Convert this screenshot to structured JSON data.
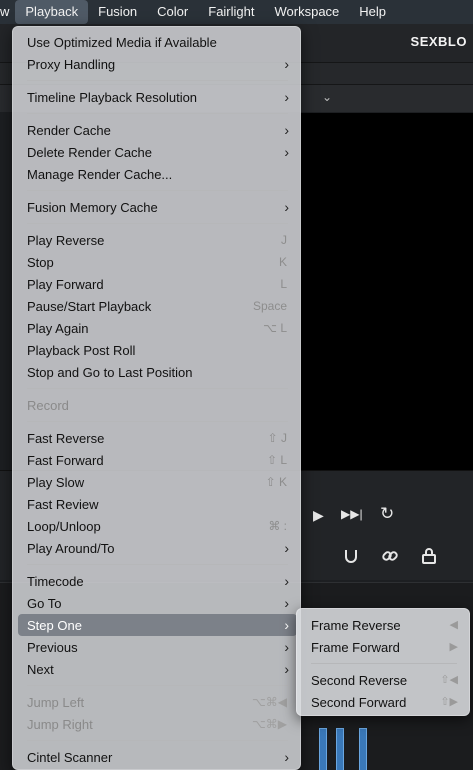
{
  "menubar": {
    "items": [
      {
        "label": "w"
      },
      {
        "label": "Playback",
        "active": true
      },
      {
        "label": "Fusion"
      },
      {
        "label": "Color"
      },
      {
        "label": "Fairlight"
      },
      {
        "label": "Workspace"
      },
      {
        "label": "Help"
      }
    ]
  },
  "app": {
    "title": "SEXBLO"
  },
  "menu": {
    "items": [
      {
        "label": "Use Optimized Media if Available",
        "shortcut": ""
      },
      {
        "label": "Proxy Handling",
        "submenu": true
      },
      {
        "label": "Timeline Playback Resolution",
        "submenu": true
      },
      {
        "label": "Render Cache",
        "submenu": true
      },
      {
        "label": "Delete Render Cache",
        "submenu": true
      },
      {
        "label": "Manage Render Cache..."
      },
      {
        "label": "Fusion Memory Cache",
        "submenu": true
      },
      {
        "label": "Play Reverse",
        "shortcut": "J"
      },
      {
        "label": "Stop",
        "shortcut": "K"
      },
      {
        "label": "Play Forward",
        "shortcut": "L"
      },
      {
        "label": "Pause/Start Playback",
        "shortcut": "Space"
      },
      {
        "label": "Play Again",
        "shortcut": "⌥ L"
      },
      {
        "label": "Playback Post Roll"
      },
      {
        "label": "Stop and Go to Last Position"
      },
      {
        "label": "Record",
        "disabled": true
      },
      {
        "label": "Fast Reverse",
        "shortcut": "⇧ J"
      },
      {
        "label": "Fast Forward",
        "shortcut": "⇧ L"
      },
      {
        "label": "Play Slow",
        "shortcut": "⇧ K"
      },
      {
        "label": "Fast Review"
      },
      {
        "label": "Loop/Unloop",
        "shortcut": "⌘ :"
      },
      {
        "label": "Play Around/To",
        "submenu": true
      },
      {
        "label": "Timecode",
        "submenu": true
      },
      {
        "label": "Go To",
        "submenu": true
      },
      {
        "label": "Step One",
        "submenu": true,
        "highlighted": true
      },
      {
        "label": "Previous",
        "submenu": true
      },
      {
        "label": "Next",
        "submenu": true
      },
      {
        "label": "Jump Left",
        "shortcut": "⌥⌘◀",
        "disabled": true
      },
      {
        "label": "Jump Right",
        "shortcut": "⌥⌘▶",
        "disabled": true
      },
      {
        "label": "Cintel Scanner",
        "submenu": true
      }
    ]
  },
  "submenu": {
    "items": [
      {
        "label": "Frame Reverse",
        "shortcut": "◀"
      },
      {
        "label": "Frame Forward",
        "shortcut": "▶"
      },
      {
        "label": "Second Reverse",
        "shortcut": "⇧◀"
      },
      {
        "label": "Second Forward",
        "shortcut": "⇧▶"
      }
    ]
  },
  "icons": {
    "submenu_arrow": "›",
    "chevron": "⌄",
    "play": "▶",
    "next": "▶▶|",
    "loop": "↻"
  },
  "colors": {
    "menubar": "#2a3138",
    "menu_bg": "#dadcdf",
    "highlight": "#7c8189",
    "accent_blue": "#3a78b8"
  }
}
